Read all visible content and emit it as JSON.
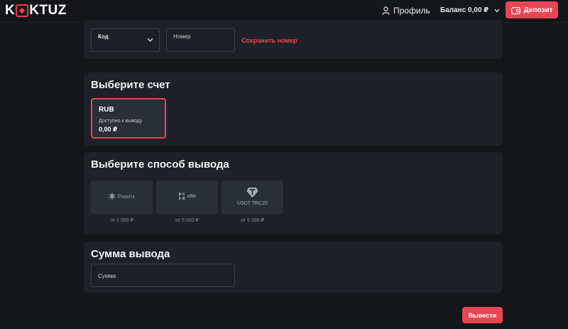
{
  "header": {
    "logo_left": "K",
    "logo_right": "KTUZ",
    "profile_label": "Профиль",
    "balance_label": "Баланс 0,00 ₽",
    "deposit_label": "Депозит"
  },
  "phone": {
    "code_label": "Код",
    "number_placeholder": "Номер",
    "save_label": "Сохранить номер"
  },
  "account": {
    "title": "Выберите счет",
    "currency": "RUB",
    "available_label": "Доступно к выводу",
    "amount": "0,00 ₽"
  },
  "methods": {
    "title": "Выберите способ вывода",
    "items": [
      {
        "name": "Piastrix",
        "min": "от 1 000 ₽"
      },
      {
        "name": "сбп",
        "min": "от 5 000 ₽"
      },
      {
        "name": "USDT TRC20",
        "min": "от 5 000 ₽"
      }
    ]
  },
  "amount": {
    "title": "Сумма вывода",
    "placeholder": "Сумма"
  },
  "withdraw_label": "Вывести",
  "colors": {
    "accent": "#e84654",
    "background": "#14161a",
    "card": "#1e2127"
  }
}
